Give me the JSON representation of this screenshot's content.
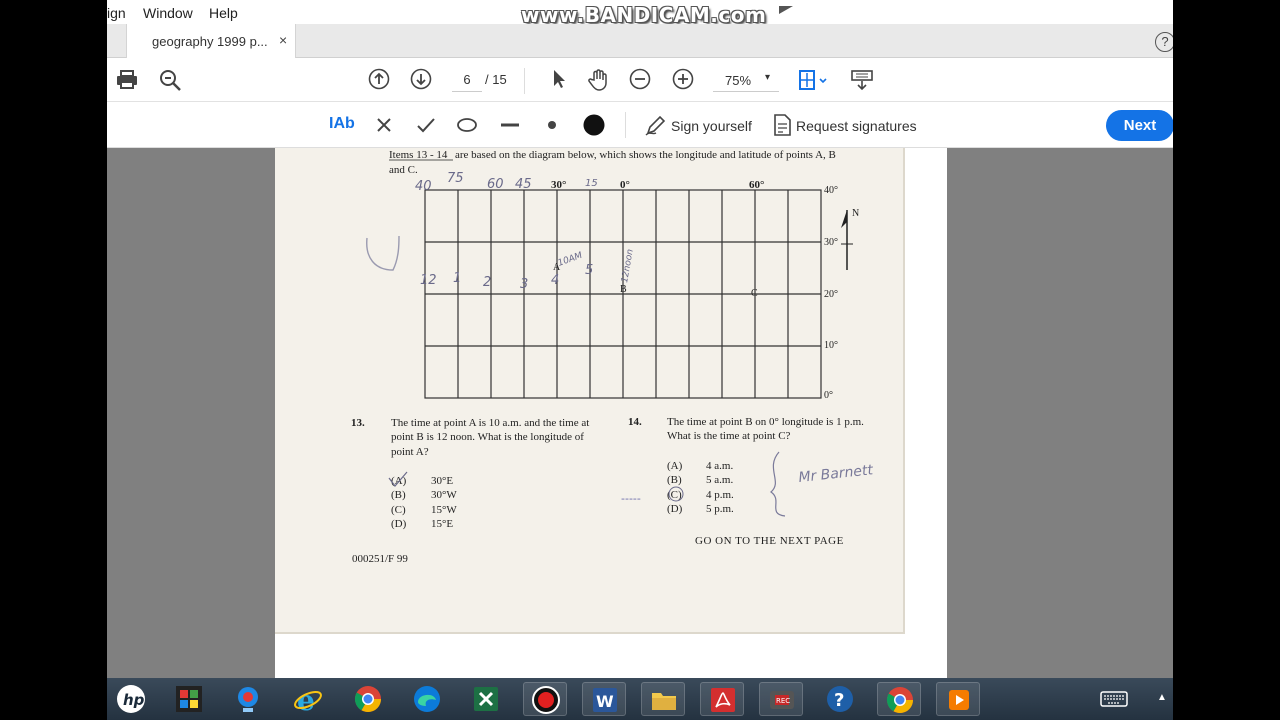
{
  "menu": {
    "items": [
      "ign",
      "Window",
      "Help"
    ]
  },
  "watermark": "www.BANDICAM.com",
  "tab": {
    "title": "geography 1999 p...",
    "close": "×"
  },
  "help_icon_glyph": "?",
  "nav": {
    "current_page": "6",
    "total_pages": "/ 15",
    "zoom": "75%",
    "zoom_caret": "▾"
  },
  "sign": {
    "text_tool": "IAb",
    "sign_yourself": "Sign yourself",
    "request_signatures": "Request signatures",
    "next": "Next"
  },
  "document": {
    "intro_underlined": "Items 13 - 14",
    "intro_rest": " are based on the diagram below, which shows the longitude and latitude of points A, B",
    "intro_line2": "and C.",
    "lon_labels": [
      "30°",
      "0°",
      "60°"
    ],
    "lat_labels": [
      "40°",
      "30°",
      "20°",
      "10°",
      "0°"
    ],
    "north": "N",
    "points": [
      "A",
      "B",
      "C"
    ],
    "q13": {
      "number": "13.",
      "text": [
        "The time at point A is 10 a.m. and the time at",
        "point B is 12 noon.  What is the longitude of",
        "point A?"
      ],
      "options": [
        {
          "letter": "(A)",
          "value": "30°E"
        },
        {
          "letter": "(B)",
          "value": "30°W"
        },
        {
          "letter": "(C)",
          "value": "15°W"
        },
        {
          "letter": "(D)",
          "value": "15°E"
        }
      ]
    },
    "q14": {
      "number": "14.",
      "text": [
        "The time at point B on 0° longitude is 1 p.m.",
        "What is the time at point C?"
      ],
      "options": [
        {
          "letter": "(A)",
          "value": "4 a.m."
        },
        {
          "letter": "(B)",
          "value": "5 a.m."
        },
        {
          "letter": "(C)",
          "value": "4 p.m."
        },
        {
          "letter": "(D)",
          "value": "5 p.m."
        }
      ]
    },
    "go_on": "GO ON TO THE NEXT PAGE",
    "footer_code": "000251/F 99",
    "handwriting": {
      "top": [
        "40",
        "75",
        "60",
        "45",
        "15"
      ],
      "row": [
        "12",
        "1",
        "2",
        "3",
        "4",
        "5"
      ],
      "a_note": "10AM",
      "col_note": "12noon",
      "signature": "Mr Barnett",
      "answer_mark": "-----"
    }
  },
  "taskbar": {
    "items": [
      "hp-logo",
      "app-store",
      "webcam-recorder",
      "internet-explorer",
      "chrome",
      "edge",
      "excel",
      "bandicam-record",
      "word",
      "file-explorer",
      "acrobat",
      "bandicam-video",
      "help",
      "chrome-2",
      "video-player"
    ]
  },
  "colors": {
    "accent": "#1473e6",
    "taskbar": "#243240",
    "viewport": "#808080"
  }
}
